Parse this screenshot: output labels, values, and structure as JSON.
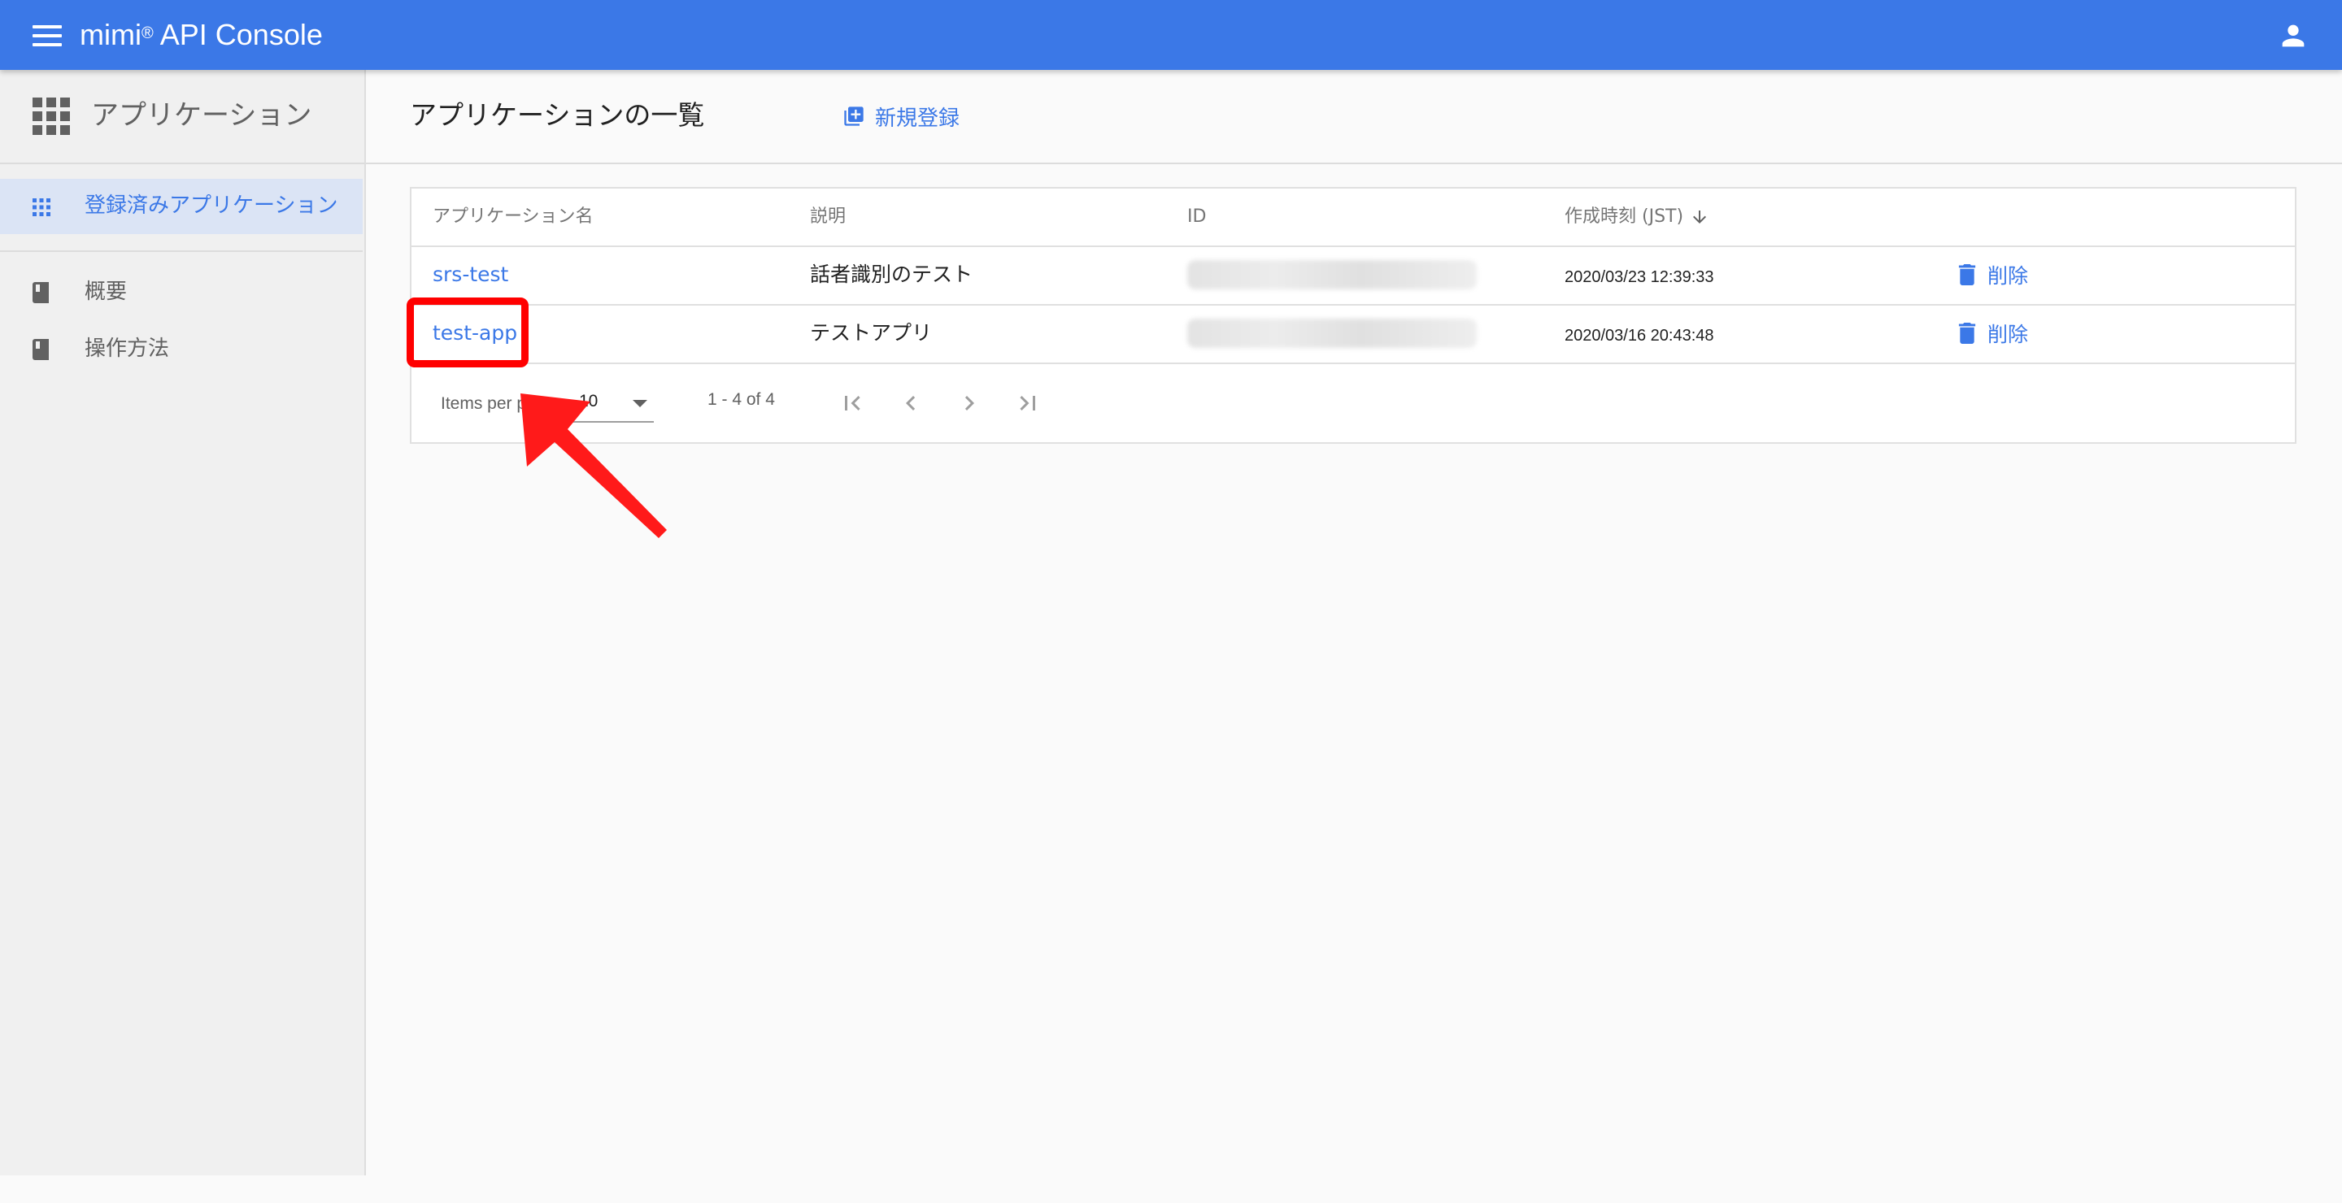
{
  "topbar": {
    "title": "mimi",
    "title_mark": "®",
    "title_suffix": " API Console",
    "menu_icon": "hamburger-menu-icon",
    "account_icon": "account-icon",
    "bar_color": "#3b78e7"
  },
  "sidebar": {
    "header_label": "アプリケーション",
    "header_icon": "apps-grid-icon",
    "active_item": {
      "label": "登録済みアプリケーション",
      "icon": "apps-grid-icon"
    },
    "items": [
      {
        "label": "概要",
        "icon": "book-icon"
      },
      {
        "label": "操作方法",
        "icon": "book-icon"
      }
    ]
  },
  "main": {
    "title": "アプリケーションの一覧",
    "new_button": {
      "label": "新規登録",
      "icon": "library-add-icon"
    }
  },
  "table": {
    "columns": {
      "name": "アプリケーション名",
      "description": "説明",
      "id": "ID",
      "created": "作成時刻 (JST)"
    },
    "sort_icon": "arrow-down-icon",
    "rows": [
      {
        "name": "srs-test",
        "description": "話者識別のテスト",
        "created": "2020/03/23 12:39:33",
        "delete_label": "削除"
      },
      {
        "name": "test-app",
        "description": "テストアプリ",
        "created": "2020/03/16 20:43:48",
        "delete_label": "削除"
      }
    ],
    "delete_icon": "trash-icon"
  },
  "paginator": {
    "items_per_page_label": "Items per page:",
    "items_per_page_value": "10",
    "range_label": "1 - 4 of 4",
    "buttons": [
      "first-page-icon",
      "previous-page-icon",
      "next-page-icon",
      "last-page-icon"
    ]
  },
  "annotation": {
    "highlight_color": "#ff0000"
  }
}
